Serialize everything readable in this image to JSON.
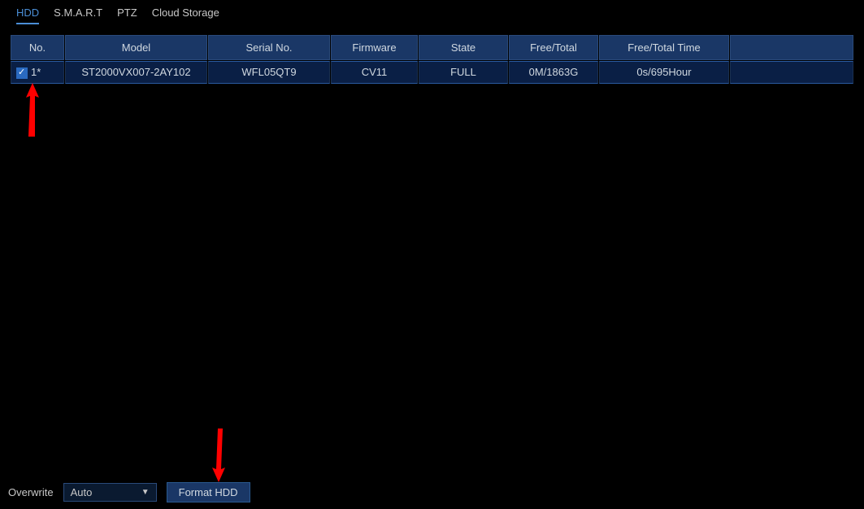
{
  "tabs": {
    "hdd": "HDD",
    "smart": "S.M.A.R.T",
    "ptz": "PTZ",
    "cloud": "Cloud Storage"
  },
  "table": {
    "headers": {
      "no": "No.",
      "model": "Model",
      "serial": "Serial No.",
      "firmware": "Firmware",
      "state": "State",
      "freetotal": "Free/Total",
      "freetime": "Free/Total Time"
    },
    "rows": [
      {
        "no": "1*",
        "model": "ST2000VX007-2AY102",
        "serial": "WFL05QT9",
        "firmware": "CV11",
        "state": "FULL",
        "freetotal": "0M/1863G",
        "freetime": "0s/695Hour"
      }
    ]
  },
  "footer": {
    "overwrite_label": "Overwrite",
    "overwrite_value": "Auto",
    "format_label": "Format HDD"
  }
}
